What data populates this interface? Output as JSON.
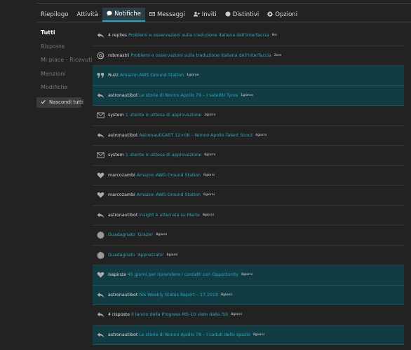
{
  "tabs": [
    {
      "label": "Riepilogo",
      "icon": ""
    },
    {
      "label": "Attività",
      "icon": ""
    },
    {
      "label": "Notifiche",
      "icon": "chat-bubble-icon"
    },
    {
      "label": "Messaggi",
      "icon": "envelope-icon"
    },
    {
      "label": "Inviti",
      "icon": "user-plus-icon"
    },
    {
      "label": "Distintivi",
      "icon": "badge-icon"
    },
    {
      "label": "Opzioni",
      "icon": "gear-icon"
    }
  ],
  "active_tab": "Notifiche",
  "sidebar": {
    "items": [
      {
        "label": "Tutti"
      },
      {
        "label": "Risposte"
      },
      {
        "label": "Mi piace - Ricevuti"
      },
      {
        "label": "Menzioni"
      },
      {
        "label": "Modifiche"
      }
    ],
    "hide_button": "Nascondi tutti"
  },
  "notifications": [
    {
      "icon": "reply-icon",
      "user": "4 replies",
      "topic": "Problemi e osservazioni sulla traduzione italiana dell'interfaccia",
      "time": "9m",
      "unread": false
    },
    {
      "icon": "at-icon",
      "user": "robmastri",
      "topic": "Problemi e osservazioni sulla traduzione italiana dell'interfaccia",
      "time": "2ore",
      "unread": false
    },
    {
      "icon": "quote-icon",
      "user": "Buzz",
      "topic": "Amazon AWS Ground Station",
      "time": "1giorno",
      "unread": true
    },
    {
      "icon": "reply-icon",
      "user": "astronautibot",
      "topic": "Le storie di Nonno Apollo 79 – I satelliti Tyros",
      "time": "1giorno",
      "unread": true
    },
    {
      "icon": "envelope-icon",
      "user": "system",
      "topic": "1 utente in attesa di approvazione",
      "time": "2giorni",
      "unread": false
    },
    {
      "icon": "reply-icon",
      "user": "astronautibot",
      "topic": "AstronautiCAST 12×08 – Nonno Apollo Talent Scout",
      "time": "4giorni",
      "unread": false
    },
    {
      "icon": "envelope-icon",
      "user": "system",
      "topic": "1 utente in attesa di approvazione",
      "time": "6giorni",
      "unread": false
    },
    {
      "icon": "heart-icon",
      "user": "marcozambi",
      "topic": "Amazon AWS Ground Station",
      "time": "6giorni",
      "unread": false
    },
    {
      "icon": "heart-icon",
      "user": "marcozambi",
      "topic": "Amazon AWS Ground Station",
      "time": "6giorni",
      "unread": false
    },
    {
      "icon": "reply-icon",
      "user": "astronautibot",
      "topic": "Insight è atterrata su Marte",
      "time": "8giorni",
      "unread": false
    },
    {
      "icon": "badge-icon",
      "user": "",
      "topic": "Guadagnato 'Grazie'",
      "time": "8giorni",
      "unread": false
    },
    {
      "icon": "badge-icon",
      "user": "",
      "topic": "Guadagnato 'Apprezzato'",
      "time": "8giorni",
      "unread": false
    },
    {
      "icon": "heart-icon",
      "user": "isapinza",
      "topic": "45 giorni per riprendere i contatti con Opportunity",
      "time": "8giorni",
      "unread": true
    },
    {
      "icon": "reply-icon",
      "user": "astronautibot",
      "topic": "ISS Weekly Status Report – 17.2018",
      "time": "8giorni",
      "unread": true
    },
    {
      "icon": "reply-icon",
      "user": "4 risposte",
      "topic": "Il lancio della Progress MS-10 visto dalla ISS",
      "time": "8giorni",
      "unread": false
    },
    {
      "icon": "reply-icon",
      "user": "astronautibot",
      "topic": "Le storie di Nonno Apollo 78 – I caduti dello spazio",
      "time": "8giorni",
      "unread": true
    }
  ],
  "colors": {
    "background": "#222222",
    "unread_row": "#123c44",
    "link": "#2aa7c2",
    "accent": "#1fa5c0"
  }
}
